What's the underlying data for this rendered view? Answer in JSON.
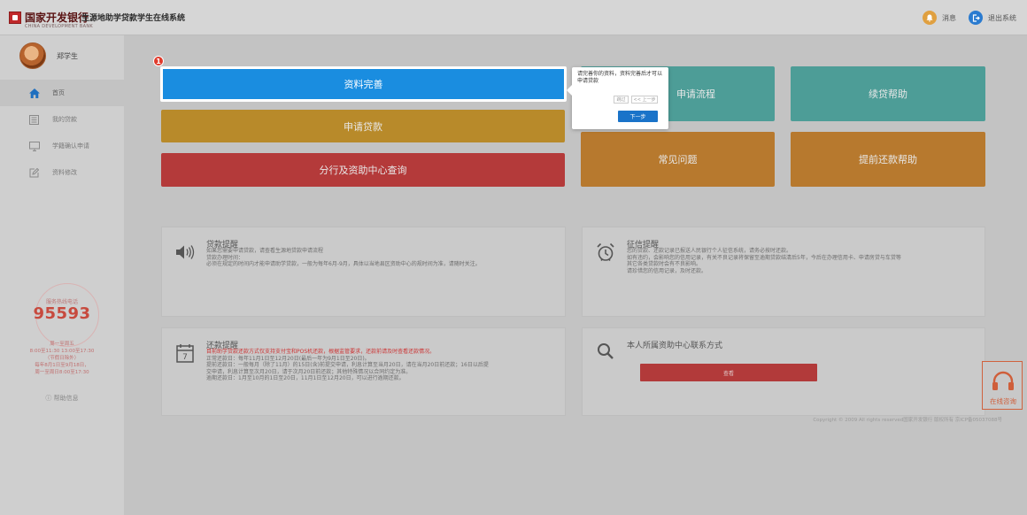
{
  "header": {
    "bank_name": "国家开发银行",
    "bank_sub": "CHINA DEVELOPMENT BANK",
    "system_name": "生源地助学贷款学生在线系统",
    "messages_label": "消息",
    "logout_label": "退出系统"
  },
  "sidebar": {
    "username": "郑学生",
    "items": [
      {
        "label": "首页",
        "icon": "home-icon"
      },
      {
        "label": "我的贷款",
        "icon": "list-icon"
      },
      {
        "label": "学籍确认申请",
        "icon": "desktop-icon"
      },
      {
        "label": "资料修改",
        "icon": "edit-icon"
      }
    ],
    "hotline_label": "服务热线电话",
    "hotline_number": "95593",
    "hours": [
      "周一至周五",
      "8:00至11:30 13:00至17:30",
      "（节假日除外）",
      "每年8月1日至9月18日，",
      "周一至周日8:00至17:30"
    ],
    "help_link": "帮助信息"
  },
  "tiles": {
    "profile": "资料完善",
    "apply": "申请贷款",
    "branch_query": "分行及资助中心查询",
    "apply_process": "申请流程",
    "renewal_help": "续贷帮助",
    "faq": "常见问题",
    "prepay_help": "提前还款帮助"
  },
  "guide": {
    "step_badge": "1",
    "text": "请完善你的资料，资料完善后才可以申请贷款",
    "skip": "跳过",
    "prev": "<< 上一步",
    "next": "下一步"
  },
  "cards": {
    "loan_reminder": {
      "title": "贷款提醒",
      "lines": [
        "如果您需要申请贷款，请查看生源地贷款申请流程",
        "贷款办理时间：",
        "必须在规定的时间内才能申请助学贷款，一般为每年6月-9月，具体以当地县区资助中心的规时间为准，请随时关注。"
      ]
    },
    "credit_reminder": {
      "title": "征信提醒",
      "lines": [
        "您的贷款、还款记录已报送人民银行个人征信系统，请务必按时还款。",
        "如有违约，会影响您的信用记录，有关不良记录将保留至逾期贷款结清后5年，今后在办理信用卡、申请房贷与车贷等",
        "其它各类贷款时会有不良影响。",
        "请珍惜您的信用记录，及时还款。"
      ]
    },
    "repay_reminder": {
      "title": "还款提醒",
      "warning": "目前助学贷款还款方式仅支持支付宝和POS机还款，根据监管要求，还款前请及时查看还款情况。",
      "lines": [
        "正常还款日：每年11月1日至12月20日(最后一年为9月1日至20日)。",
        "提前还款日：一般每月（除了11月）的15日(含)前提交申请，利息计算至当月20日，请在当月20日前还款；16日以后提",
        "交申请，利息计算至次月20日，请于次月20日前还款；其他特殊情况以合同约定为准。",
        "逾期还款日：1月至10月的1日至20日，11月1日至12月20日，可以进行逾期还款。"
      ],
      "calendar_day": "7"
    },
    "contact": {
      "title": "本人所属资助中心联系方式",
      "button": "查看"
    }
  },
  "footer": {
    "copyright": "Copyright © 2009 All rights reserved国家开发银行 版权所有 京ICP备05037088号"
  },
  "online_consult": "在线咨询",
  "colors": {
    "primary_blue": "#1a8de0",
    "brand_red": "#c0282a",
    "hotline_red": "#c74a3e"
  }
}
